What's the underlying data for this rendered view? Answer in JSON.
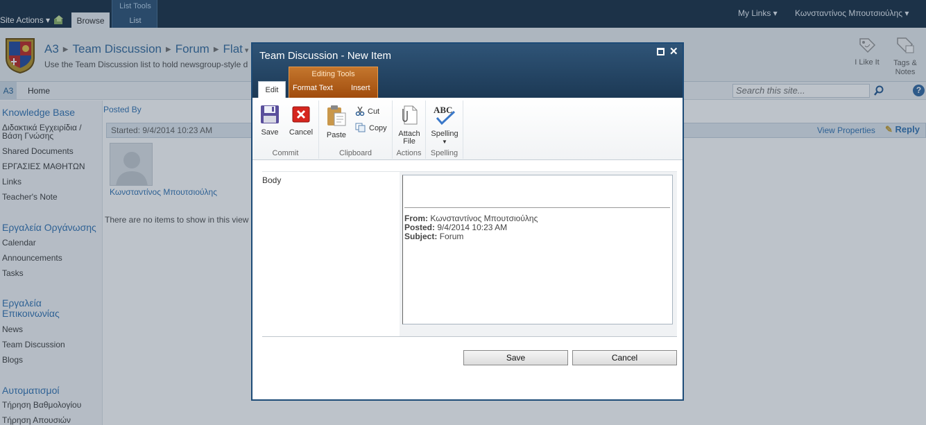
{
  "topbar": {
    "site_actions": "Site Actions",
    "tab_browse": "Browse",
    "list_tools": "List Tools",
    "tab_list": "List",
    "my_links": "My Links",
    "user": "Κωνσταντίνος Μπουτσιούλης"
  },
  "header": {
    "breadcrumb": [
      "A3",
      "Team Discussion",
      "Forum",
      "Flat"
    ],
    "description": "Use the Team Discussion list to hold newsgroup-style d",
    "like_it": "I Like It",
    "tags_notes_1": "Tags &",
    "tags_notes_2": "Notes"
  },
  "topnav": {
    "site": "A3",
    "home": "Home",
    "search_placeholder": "Search this site..."
  },
  "leftnav": {
    "sections": [
      {
        "heading": "Knowledge Base",
        "items": [
          "Διδακτικά Εγχειρίδια /",
          "Βάση Γνώσης",
          "Shared Documents",
          "ΕΡΓΑΣΙΕΣ ΜΑΘΗΤΩΝ",
          "Links",
          "Teacher's Note"
        ]
      },
      {
        "heading": "Εργαλεία Οργάνωσης",
        "items": [
          "Calendar",
          "Announcements",
          "Tasks"
        ]
      },
      {
        "heading_1": "Εργαλεία",
        "heading_2": "Επικοινωνίας",
        "items": [
          "News",
          "Team Discussion",
          "Blogs"
        ]
      },
      {
        "heading": "Αυτοματισμοί",
        "items": [
          "Τήρηση Βαθμολογίου",
          "Τήρηση Απουσιών"
        ]
      }
    ]
  },
  "main": {
    "posted_by": "Posted By",
    "started": "Started: 9/4/2014 10:23 AM",
    "view_properties": "View Properties",
    "reply": "Reply",
    "author": "Κωνσταντίνος Μπουτσιούλης",
    "no_items": "There are no items to show in this view of th"
  },
  "dialog": {
    "title": "Team Discussion - New Item",
    "editing_tools": "Editing Tools",
    "tabs": [
      "Edit",
      "Format Text",
      "Insert"
    ],
    "ribbon": {
      "save": "Save",
      "cancel": "Cancel",
      "commit": "Commit",
      "paste": "Paste",
      "cut": "Cut",
      "copy": "Copy",
      "clipboard": "Clipboard",
      "attach_1": "Attach",
      "attach_2": "File",
      "actions": "Actions",
      "spelling_btn": "Spelling",
      "spelling_group": "Spelling"
    },
    "form": {
      "body_label": "Body",
      "from_label": "From:",
      "from_value": "Κωνσταντίνος Μπουτσιούλης",
      "posted_label": "Posted:",
      "posted_value": "9/4/2014 10:23 AM",
      "subject_label": "Subject:",
      "subject_value": "Forum"
    },
    "buttons": {
      "save": "Save",
      "cancel": "Cancel"
    }
  },
  "colors": {
    "topbar": "#21374c",
    "link": "#3a78b5",
    "editing_tools": "#b35f1a",
    "dialog_border": "#1d4b77"
  }
}
